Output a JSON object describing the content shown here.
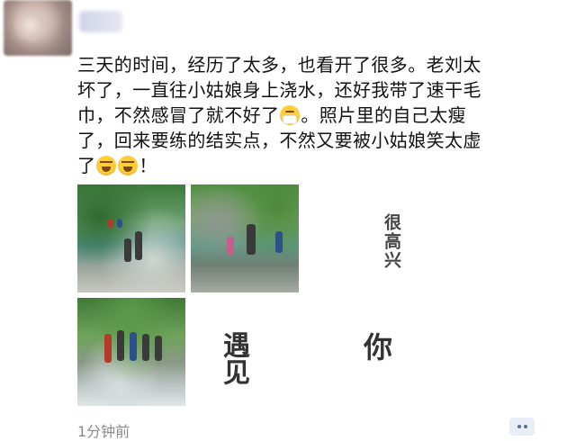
{
  "post": {
    "lines": [
      "三天的时间，经历了太多，也看开了很多。老刘太",
      "坏了，一直往小姑娘身上浇水，还好我带了速干毛",
      "巾，不然感冒了就不好了",
      "。照片里的自己太瘦",
      "了，回来要练的结实点，不然又要被小姑娘笑太虚",
      "了",
      "！"
    ],
    "emoji": {
      "mask": "mask-emoji",
      "cry1": "tears-of-joy-emoji",
      "cry2": "tears-of-joy-emoji"
    }
  },
  "images": {
    "text_henhigh": "很高兴",
    "text_yujian": "遇见",
    "text_ni": "你"
  },
  "meta": {
    "time": "1分钟前"
  },
  "icons": {
    "more": "more-dots-icon"
  },
  "colors": {
    "link": "#5b6f97",
    "time": "#8a8a8a"
  }
}
